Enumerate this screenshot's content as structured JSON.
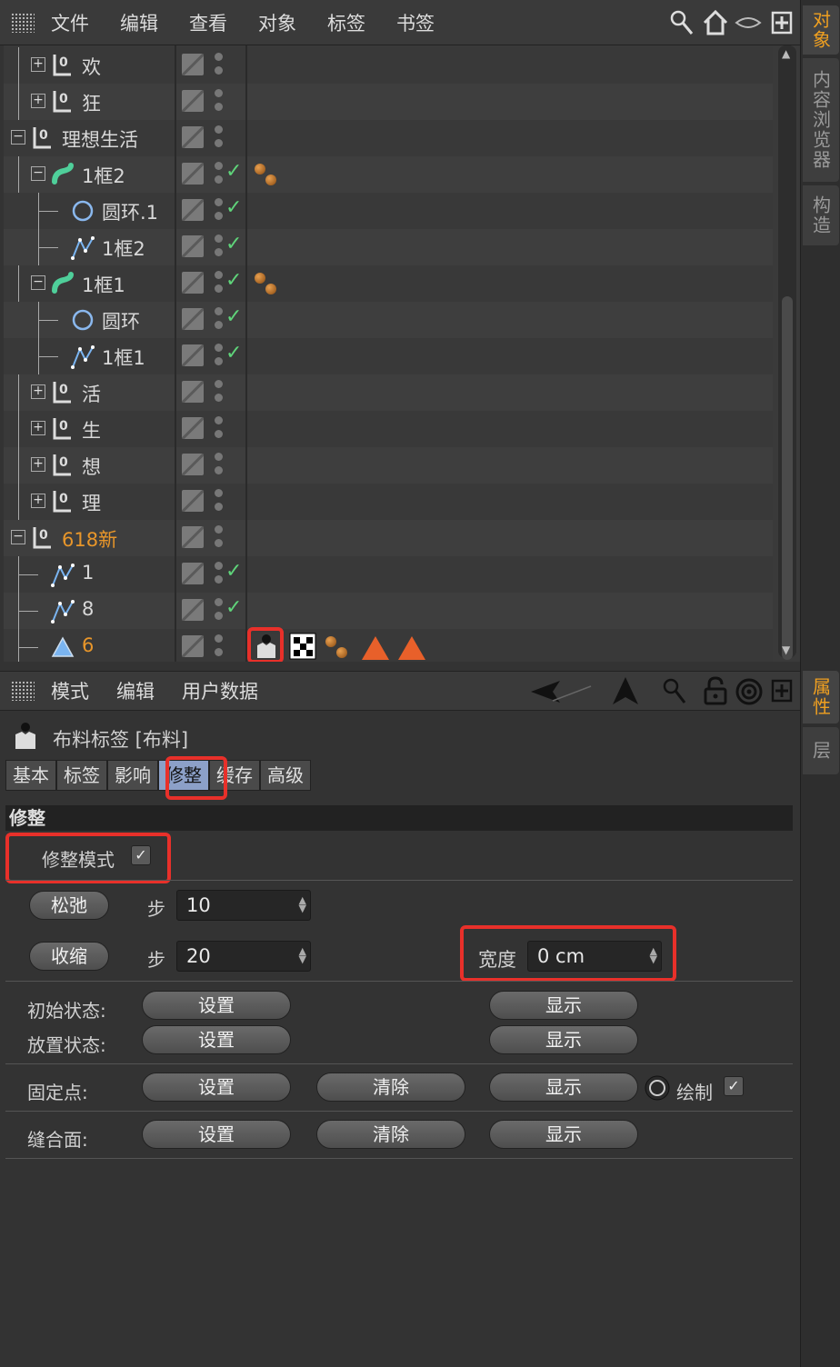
{
  "object_manager": {
    "menu": [
      "文件",
      "编辑",
      "查看",
      "对象",
      "标签",
      "书签"
    ],
    "rows": [
      {
        "label": "欢",
        "icon": "null-icon",
        "expand": "+",
        "check": false
      },
      {
        "label": "狂",
        "icon": "null-icon",
        "expand": "+",
        "check": false
      },
      {
        "label": "理想生活",
        "icon": "null-icon",
        "expand": "-",
        "check": false
      },
      {
        "label": "1框2",
        "icon": "sweep-icon",
        "expand": "-",
        "check": true
      },
      {
        "label": "圆环.1",
        "icon": "circle-icon",
        "expand": "",
        "check": true
      },
      {
        "label": "1框2",
        "icon": "spline-icon",
        "expand": "",
        "check": true
      },
      {
        "label": "1框1",
        "icon": "sweep-icon",
        "expand": "-",
        "check": true
      },
      {
        "label": "圆环",
        "icon": "circle-icon",
        "expand": "",
        "check": true
      },
      {
        "label": "1框1",
        "icon": "spline-icon",
        "expand": "",
        "check": true
      },
      {
        "label": "活",
        "icon": "null-icon",
        "expand": "+",
        "check": false
      },
      {
        "label": "生",
        "icon": "null-icon",
        "expand": "+",
        "check": false
      },
      {
        "label": "想",
        "icon": "null-icon",
        "expand": "+",
        "check": false
      },
      {
        "label": "理",
        "icon": "null-icon",
        "expand": "+",
        "check": false
      },
      {
        "label": "618新",
        "icon": "null-icon",
        "expand": "-",
        "check": false
      },
      {
        "label": "1",
        "icon": "spline-icon",
        "expand": "",
        "check": true
      },
      {
        "label": "8",
        "icon": "spline-icon",
        "expand": "",
        "check": true
      },
      {
        "label": "6",
        "icon": "polygon-icon",
        "expand": "",
        "check": false
      }
    ]
  },
  "side_tabs": {
    "top": [
      "对象",
      "内容浏览器",
      "构造"
    ],
    "bottom": [
      "属性",
      "层"
    ]
  },
  "attribute_manager": {
    "menu": [
      "模式",
      "编辑",
      "用户数据"
    ],
    "tag_title": "布料标签 [布料]",
    "tabs": [
      "基本",
      "标签",
      "影响",
      "修整",
      "缓存",
      "高级"
    ],
    "active_tab": "修整",
    "section": "修整",
    "trim_mode_label": "修整模式",
    "relax_button": "松弛",
    "shrink_button": "收缩",
    "step_label": "步",
    "relax_steps": "10",
    "shrink_steps": "20",
    "width_label": "宽度",
    "width_value": "0 cm",
    "init_state_label": "初始状态:",
    "dress_state_label": "放置状态:",
    "fix_points_label": "固定点:",
    "seam_label": "缝合面:",
    "set_label": "设置",
    "show_label": "显示",
    "clear_label": "清除",
    "draw_label": "绘制"
  },
  "colors": {
    "accent": "#f0a020",
    "highlight": "#e8302a",
    "check": "#5fd47a"
  }
}
